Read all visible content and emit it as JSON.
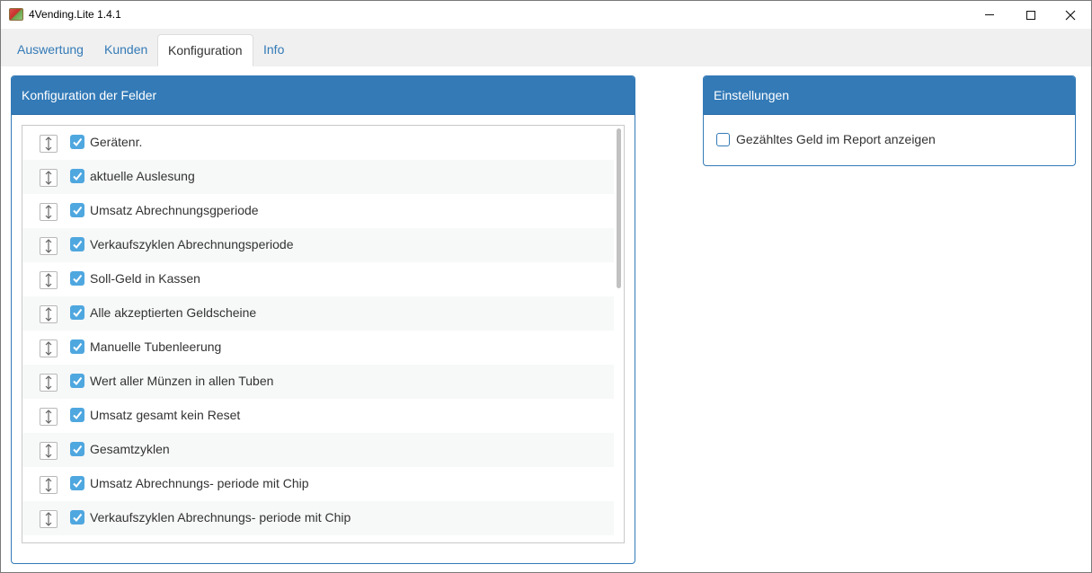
{
  "window": {
    "title": "4Vending.Lite 1.4.1",
    "controls": {
      "minimize": "minimize",
      "maximize": "maximize",
      "close": "✕"
    }
  },
  "tabs": [
    {
      "label": "Auswertung"
    },
    {
      "label": "Kunden"
    },
    {
      "label": "Konfiguration",
      "active": true
    },
    {
      "label": "Info"
    }
  ],
  "fields_panel": {
    "heading": "Konfiguration der Felder",
    "items": [
      {
        "label": "Gerätenr.",
        "checked": true
      },
      {
        "label": "aktuelle Auslesung",
        "checked": true
      },
      {
        "label": "Umsatz Abrechnungsgperiode",
        "checked": true
      },
      {
        "label": "Verkaufszyklen Abrechnungsperiode",
        "checked": true
      },
      {
        "label": "Soll-Geld in Kassen",
        "checked": true
      },
      {
        "label": "Alle akzeptierten Geldscheine",
        "checked": true
      },
      {
        "label": "Manuelle Tubenleerung",
        "checked": true
      },
      {
        "label": "Wert aller Münzen in allen Tuben",
        "checked": true
      },
      {
        "label": "Umsatz gesamt kein Reset",
        "checked": true
      },
      {
        "label": "Gesamtzyklen",
        "checked": true
      },
      {
        "label": "Umsatz Abrechnungs- periode mit Chip",
        "checked": true
      },
      {
        "label": "Verkaufszyklen Abrechnungs- periode mit Chip",
        "checked": true
      }
    ]
  },
  "settings_panel": {
    "heading": "Einstellungen",
    "option": {
      "label": "Gezähltes Geld im Report anzeigen",
      "checked": false
    }
  },
  "colors": {
    "accent": "#337ab7",
    "checkbox": "#4fa7df"
  }
}
